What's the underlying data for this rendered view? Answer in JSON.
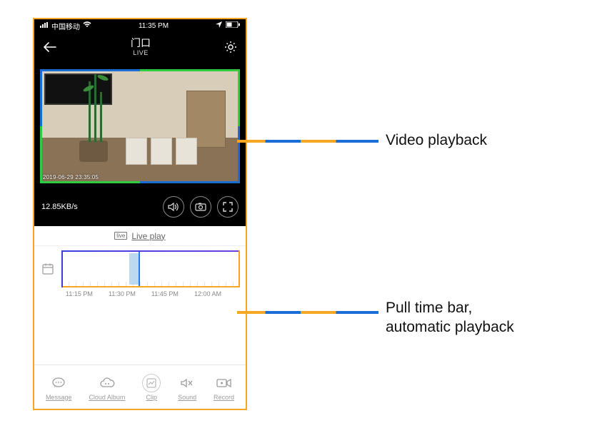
{
  "status_bar": {
    "carrier": "中国移动",
    "time": "11:35 PM"
  },
  "header": {
    "title": "门口",
    "subtitle": "LIVE"
  },
  "video": {
    "timestamp_overlay": "2019-06-29  23:35:05",
    "bitrate": "12.85KB/s"
  },
  "live_tab": {
    "badge": "live",
    "label": "Live play"
  },
  "timeline": {
    "labels": [
      "11:15 PM",
      "11:30 PM",
      "11:45 PM",
      "12:00 AM"
    ]
  },
  "bottom_nav": {
    "items": [
      {
        "label": "Message"
      },
      {
        "label": "Cloud Album"
      },
      {
        "label": "Clip"
      },
      {
        "label": "Sound"
      },
      {
        "label": "Record"
      }
    ]
  },
  "annotations": {
    "video_playback": "Video playback",
    "time_bar_line1": "Pull time bar,",
    "time_bar_line2": "automatic playback"
  }
}
